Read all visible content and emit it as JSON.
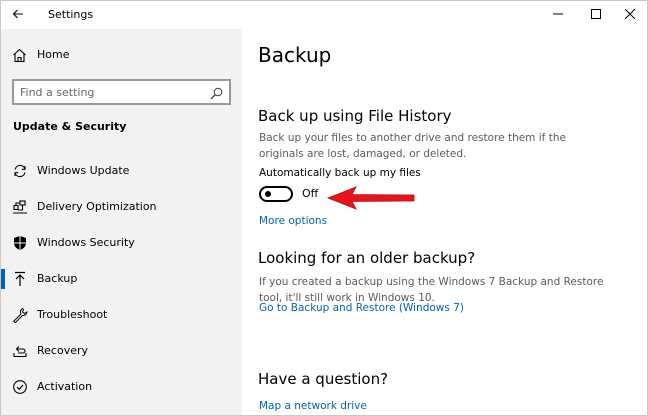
{
  "window": {
    "title": "Settings"
  },
  "sidebar": {
    "home_label": "Home",
    "search_placeholder": "Find a setting",
    "section_title": "Update & Security",
    "items": [
      {
        "label": "Windows Update",
        "icon": "sync-icon"
      },
      {
        "label": "Delivery Optimization",
        "icon": "delivery-optimization-icon"
      },
      {
        "label": "Windows Security",
        "icon": "shield-icon"
      },
      {
        "label": "Backup",
        "icon": "backup-arrow-icon",
        "active": true
      },
      {
        "label": "Troubleshoot",
        "icon": "wrench-icon"
      },
      {
        "label": "Recovery",
        "icon": "recovery-icon"
      },
      {
        "label": "Activation",
        "icon": "activation-check-icon"
      }
    ]
  },
  "main": {
    "title": "Backup",
    "file_history": {
      "heading": "Back up using File History",
      "description": "Back up your files to another drive and restore them if the originals are lost, damaged, or deleted.",
      "toggle_label": "Automatically back up my files",
      "toggle_state": "Off",
      "more_options": "More options"
    },
    "older_backup": {
      "heading": "Looking for an older backup?",
      "description": "If you created a backup using the Windows 7 Backup and Restore tool, it'll still work in Windows 10.",
      "link": "Go to Backup and Restore (Windows 7)"
    },
    "question": {
      "heading": "Have a question?",
      "link": "Map a network drive"
    }
  },
  "colors": {
    "accent": "#0063b1",
    "sidebar_bg": "#f2f2f2",
    "annotation_arrow": "#e8141b"
  }
}
